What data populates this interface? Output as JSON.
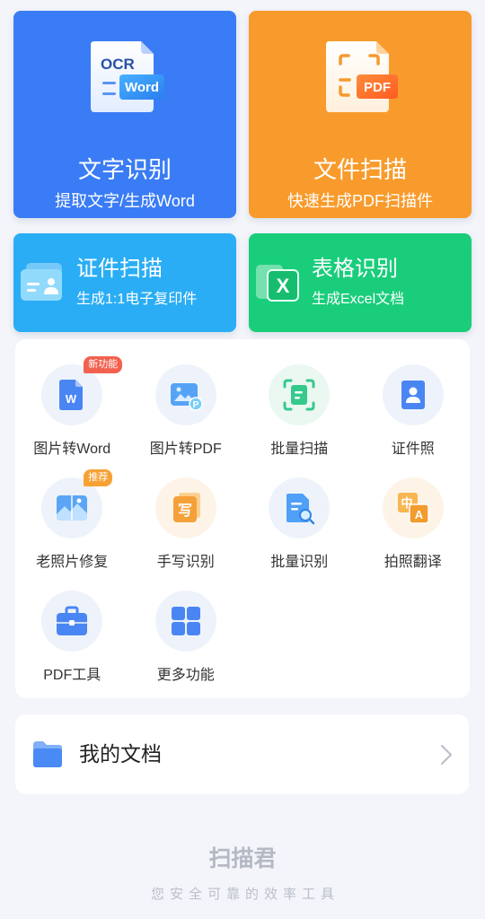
{
  "colors": {
    "background": "#f3f5fa"
  },
  "feature_cards": [
    {
      "title": "文字识别",
      "subtitle": "提取文字/生成Word",
      "icon": "ocr-to-word-document-icon",
      "icon_text": "OCR",
      "icon_badge": "Word",
      "color": "#3a7cf5"
    },
    {
      "title": "文件扫描",
      "subtitle": "快速生成PDF扫描件",
      "icon": "pdf-scan-document-icon",
      "icon_badge": "PDF",
      "color": "#f89b2c"
    },
    {
      "title": "证件扫描",
      "subtitle": "生成1:1电子复印件",
      "icon": "id-card-icon",
      "color": "#2aadf5"
    },
    {
      "title": "表格识别",
      "subtitle": "生成Excel文档",
      "icon": "excel-sheet-icon",
      "icon_text": "X",
      "color": "#19cd7b"
    }
  ],
  "tools": [
    {
      "label": "图片转Word",
      "icon": "image-to-word-icon",
      "glyph": "W",
      "badge": "新功能",
      "badge_color": "#f2614f"
    },
    {
      "label": "图片转PDF",
      "icon": "image-to-pdf-icon",
      "glyph": "P"
    },
    {
      "label": "批量扫描",
      "icon": "batch-scan-icon"
    },
    {
      "label": "证件照",
      "icon": "id-photo-icon"
    },
    {
      "label": "老照片修复",
      "icon": "photo-restore-icon",
      "badge": "推荐",
      "badge_color": "#f7a135"
    },
    {
      "label": "手写识别",
      "icon": "handwriting-icon",
      "glyph": "写"
    },
    {
      "label": "批量识别",
      "icon": "batch-recognize-icon"
    },
    {
      "label": "拍照翻译",
      "icon": "photo-translate-icon",
      "glyph": "中",
      "glyph_2": "A"
    },
    {
      "label": "PDF工具",
      "icon": "pdf-tools-icon"
    },
    {
      "label": "更多功能",
      "icon": "more-features-icon"
    }
  ],
  "my_documents": {
    "label": "我的文档",
    "icon": "folder-icon",
    "action_icon": "chevron-right-icon"
  },
  "footer": {
    "brand": "扫描君",
    "slogan": "您安全可靠的效率工具"
  }
}
